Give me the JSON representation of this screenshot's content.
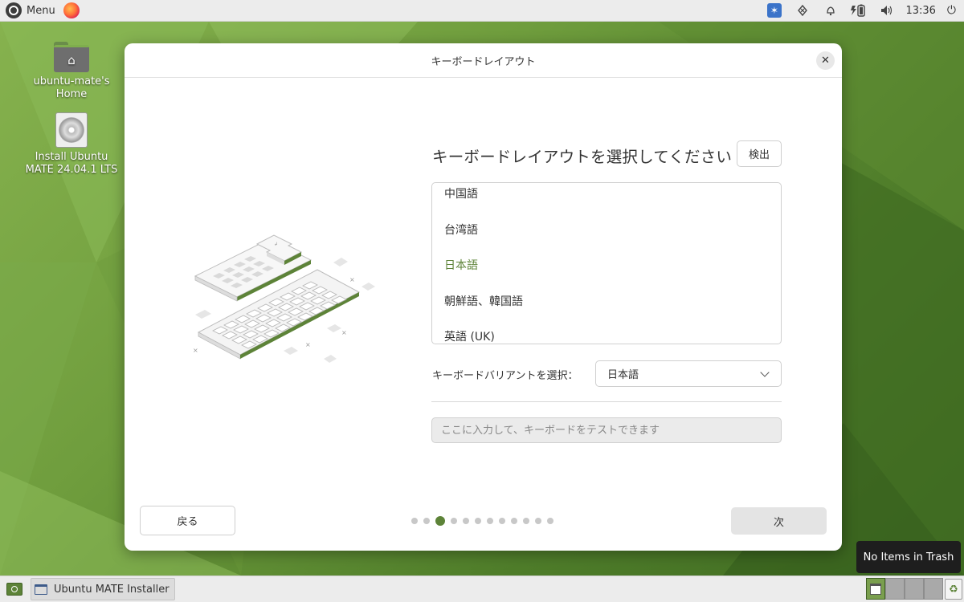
{
  "top_panel": {
    "menu_label": "Menu",
    "clock": "13:36"
  },
  "desktop_icons": [
    {
      "label": "ubuntu-mate's Home"
    },
    {
      "label": "Install Ubuntu MATE 24.04.1 LTS"
    }
  ],
  "dialog": {
    "title": "キーボードレイアウト",
    "heading": "キーボードレイアウトを選択してください",
    "detect_label": "検出",
    "layouts": [
      "中国語",
      "台湾語",
      "日本語",
      "朝鮮語、韓国語",
      "英語 (UK)"
    ],
    "selected_layout": "日本語",
    "variant_label": "キーボードバリアントを選択：",
    "variant_value": "日本語",
    "test_placeholder": "ここに入力して、キーボードをテストできます",
    "back_label": "戻る",
    "next_label": "次",
    "progress": {
      "total_steps": 12,
      "current_step": 3
    }
  },
  "tooltip": "No Items in Trash",
  "bottom_panel": {
    "task_label": "Ubuntu MATE Installer"
  },
  "colors": {
    "accent": "#5d8338",
    "panel": "#ececec"
  }
}
